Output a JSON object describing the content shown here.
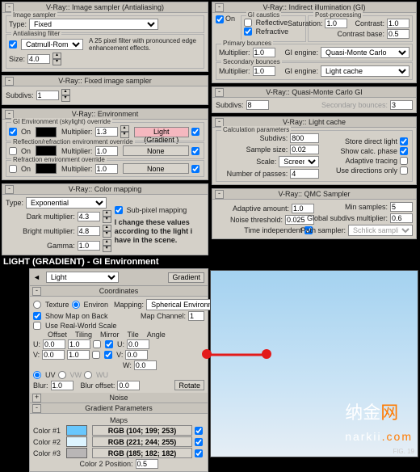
{
  "imgSampler": {
    "title": "V-Ray:: Image sampler (Antialiasing)",
    "type_lbl": "Type:",
    "type": "Fixed",
    "aa_grp": "Antialiasing filter",
    "aa_on": true,
    "aa_filter": "Catmull-Rom",
    "aa_note": "A 25 pixel filter with pronounced edge enhancement effects.",
    "size_lbl": "Size:",
    "size": "4.0"
  },
  "fixed": {
    "title": "V-Ray:: Fixed image sampler",
    "subdivs_lbl": "Subdivs:",
    "subdivs": "1"
  },
  "env": {
    "title": "V-Ray:: Environment",
    "gi_grp": "GI Environment (skylight) override",
    "on_lbl": "On",
    "on": true,
    "mult_lbl": "Multiplier:",
    "mult": "1.3",
    "map": "Light  (Gradient )",
    "refl_grp": "Reflection/refraction environment override",
    "refl_on": false,
    "refl_mult": "1.0",
    "refl_map": "None",
    "refr_grp": "Refraction environment override",
    "refr_on": false,
    "refr_mult": "1.0",
    "refr_map": "None"
  },
  "cmap": {
    "title": "V-Ray:: Color mapping",
    "type_lbl": "Type:",
    "type": "Exponential",
    "dark_lbl": "Dark multiplier:",
    "dark": "4.3",
    "bright_lbl": "Bright multiplier:",
    "bright": "4.8",
    "gamma_lbl": "Gamma:",
    "gamma": "1.0",
    "subpx": "Sub-pixel mapping",
    "note": "I change these values according to the light i have in the scene."
  },
  "gi": {
    "title": "V-Ray:: Indirect illumination (GI)",
    "on": "On",
    "caustics": "GI caustics",
    "reflective": "Reflective",
    "refractive": "Refractive",
    "post": "Post-processing",
    "sat_lbl": "Saturation:",
    "sat": "1.0",
    "contrast_lbl": "Contrast:",
    "contrast": "1.0",
    "cbase_lbl": "Contrast base:",
    "cbase": "0.5",
    "prim": "Primary bounces",
    "sec": "Secondary bounces",
    "mult_lbl": "Multiplier:",
    "pmult": "1.0",
    "pengine": "Quasi-Monte Carlo",
    "smult": "1.0",
    "sengine": "Light cache",
    "eng_lbl": "GI engine:"
  },
  "qmc": {
    "title": "V-Ray:: Quasi-Monte Carlo GI",
    "subdivs_lbl": "Subdivs:",
    "subdivs": "8",
    "sec_lbl": "Secondary bounces:",
    "sec": "3"
  },
  "lcache": {
    "title": "V-Ray:: Light cache",
    "calc": "Calculation parameters",
    "subdivs_lbl": "Subdivs:",
    "subdivs": "800",
    "sample_lbl": "Sample size:",
    "sample": "0.02",
    "scale_lbl": "Scale:",
    "scale": "Screen",
    "passes_lbl": "Number of passes:",
    "passes": "4",
    "store": "Store direct light",
    "showphase": "Show calc. phase",
    "adaptive": "Adaptive tracing",
    "usedir": "Use directions only"
  },
  "qmcS": {
    "title": "V-Ray:: QMC Sampler",
    "adapt_lbl": "Adaptive amount:",
    "adapt": "1.0",
    "noise_lbl": "Noise threshold:",
    "noise": "0.025",
    "time_lbl": "Time independent",
    "min_lbl": "Min samples:",
    "min": "5",
    "glob_lbl": "Global subdivs multiplier:",
    "glob": "0.6",
    "path_lbl": "Path sampler:",
    "path": "Schlick sampling"
  },
  "gradHeader": "LIGHT (GRADIENT) - GI Environment",
  "coords": {
    "title": "Coordinates",
    "dd": "Light",
    "tab2": "Gradient",
    "texture": "Texture",
    "environ": "Environ",
    "mapping_lbl": "Mapping:",
    "mapping": "Spherical Environment",
    "showmap": "Show Map on Back",
    "mapch": "Map Channel:",
    "mapch_v": "1",
    "userw": "Use Real-World Scale",
    "h_off": "Offset",
    "h_til": "Tiling",
    "h_mir": "Mirror",
    "h_tile": "Tile",
    "h_ang": "Angle",
    "U": "U:",
    "V": "V:",
    "W": "W:",
    "u_off": "0.0",
    "u_til": "1.0",
    "u_ang": "0.0",
    "v_off": "0.0",
    "v_til": "1.0",
    "v_ang": "0.0",
    "w_ang": "0.0",
    "UV": "UV",
    "VW": "VW",
    "WU": "WU",
    "blur_lbl": "Blur:",
    "blur": "1.0",
    "bluroff_lbl": "Blur offset:",
    "bluroff": "0.0",
    "rotate": "Rotate"
  },
  "noise": {
    "title": "Noise"
  },
  "gparams": {
    "title": "Gradient Parameters",
    "maps": "Maps",
    "c1_lbl": "Color #1",
    "c1_rgb": "RGB (104; 199; 253)",
    "c1": "#68c7fd",
    "c2_lbl": "Color #2",
    "c2_rgb": "RGB (221; 244; 255)",
    "c2": "#ddf4ff",
    "c3_lbl": "Color #3",
    "c3_rgb": "RGB (185; 182; 182)",
    "c3": "#b9b6b6",
    "pos_lbl": "Color 2 Position:",
    "pos": "0.5"
  },
  "logo": {
    "t1": "纳金",
    "t2": "网",
    "d": "narkii",
    "com": ".com"
  },
  "fig": "FIG. 19"
}
